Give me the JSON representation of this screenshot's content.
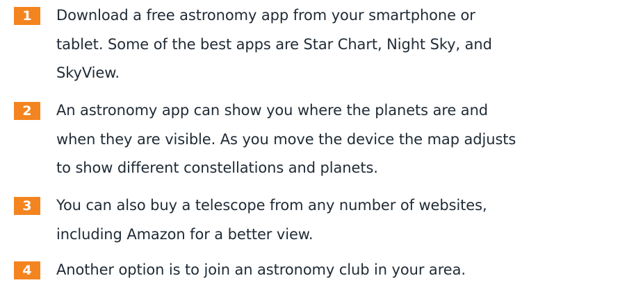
{
  "steps": [
    {
      "number": "1",
      "lines": [
        "Download a free astronomy app from your smartphone or",
        "tablet. Some of the best apps are Star Chart, Night Sky, and",
        "SkyView."
      ]
    },
    {
      "number": "2",
      "lines": [
        "An astronomy app can show you where the planets are and",
        "when they are visible. As you move the device the map adjusts",
        "to show different constellations and planets."
      ]
    },
    {
      "number": "3",
      "lines": [
        "You can also buy a telescope from any number of websites,",
        "including Amazon for a better view."
      ]
    },
    {
      "number": "4",
      "lines": [
        "Another option is to join an astronomy club in your area."
      ]
    }
  ],
  "colors": {
    "badge": "#f4841f",
    "text": "#1f2a35",
    "background": "#ffffff"
  }
}
